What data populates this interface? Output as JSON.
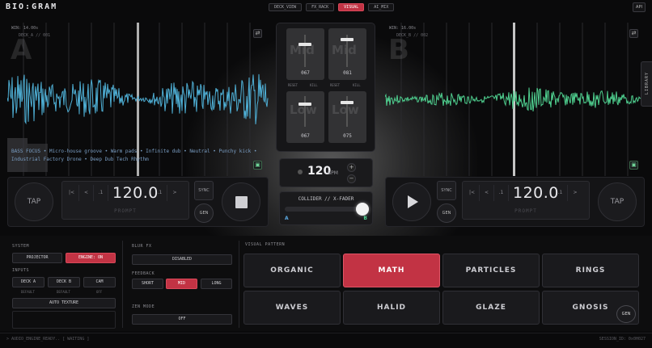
{
  "app": {
    "logo": "BIO:GRAM"
  },
  "tabs": [
    {
      "label": "DECK_VIEW",
      "active": false
    },
    {
      "label": "FX_RACK",
      "active": false
    },
    {
      "label": "VISUAL",
      "active": true
    },
    {
      "label": "AI_MIX",
      "active": false
    }
  ],
  "api_label": "API",
  "deck_a": {
    "win": "WIN: 14.00s",
    "sub": "DECK_A // 001",
    "letter": "A",
    "ticker": "BASS FOCUS • Micro-house groove • Warm pads • Infinite dub • Neutral • Punchy kick • Industrial Factory Drone • Deep Dub Tech Rhythm",
    "tap": "TAP",
    "bpm": "120.0",
    "prompt": "PROMPT",
    "sync": "SYNC",
    "gen": "GEN",
    "pitch_cells": [
      "|<",
      "<",
      ".1",
      "",
      ".1",
      ">"
    ]
  },
  "deck_b": {
    "win": "WIN: 16.00s",
    "sub": "DECK_B // 002",
    "letter": "B",
    "tap": "TAP",
    "bpm": "120.0",
    "prompt": "PROMPT",
    "sync": "SYNC",
    "gen": "GEN",
    "pitch_cells": [
      "|<",
      "<",
      ".1",
      "",
      ".1",
      ">"
    ]
  },
  "mixer": {
    "mid_word": "Mid",
    "low_word": "Low",
    "a_mid": "067",
    "b_mid": "081",
    "a_low": "067",
    "b_low": "075",
    "reset": "RESET",
    "kill": "KILL"
  },
  "bpm_panel": {
    "value": "120",
    "unit": "BPM",
    "plus": "+",
    "minus": "−"
  },
  "xfader": {
    "title": "COLLIDER // X-FADER",
    "left": "A",
    "right": "B",
    "position": 0.92
  },
  "system": {
    "label": "SYSTEM",
    "projector": "PROJECTOR",
    "engine": "ENGINE: ON",
    "inputs_label": "INPUTS",
    "deck_a": "DECK A",
    "deck_b": "DECK B",
    "cam": "CAM",
    "deck_a_sub": "DEFAULT",
    "deck_b_sub": "DEFAULT",
    "cam_sub": "OFF",
    "auto_texture": "AUTO TEXTURE"
  },
  "blur": {
    "label": "BLUR FX",
    "state": "DISABLED",
    "feedback_label": "FEEDBACK",
    "short": "SHORT",
    "mid": "MID",
    "long": "LONG",
    "zen_label": "ZEN MODE",
    "zen_state": "OFF"
  },
  "visual_pattern": {
    "label": "VISUAL PATTERN",
    "items": [
      "ORGANIC",
      "MATH",
      "PARTICLES",
      "RINGS",
      "WAVES",
      "HALID",
      "GLAZE",
      "GNOSIS"
    ],
    "active": "MATH",
    "gen": "GEN"
  },
  "footer": {
    "left": "> AUDIO_ENGINE_READY..  [ WAITING ]",
    "right": "SESSION_ID: 0x0H027"
  },
  "library": "LIBRARY",
  "colors": {
    "accent": "#c23344",
    "wave_a": "#4fb0d6",
    "wave_b": "#4fcf8f"
  }
}
